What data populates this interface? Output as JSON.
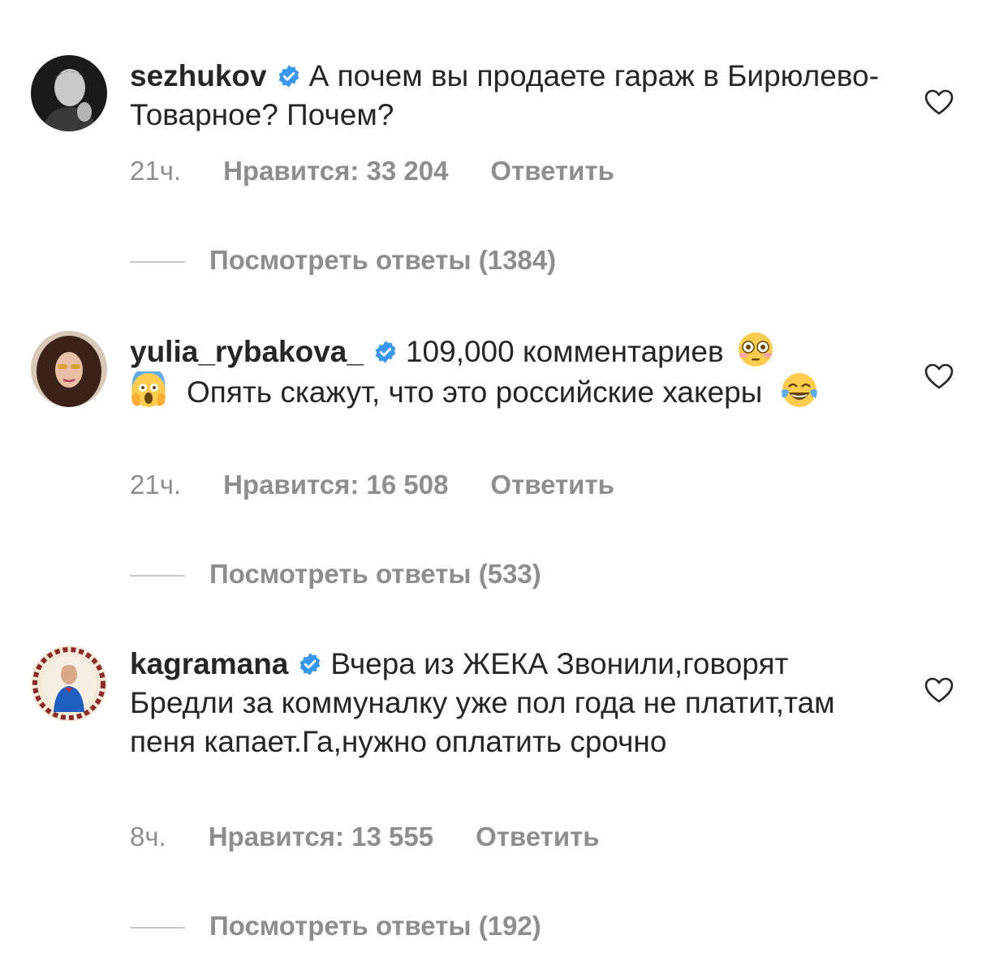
{
  "comments": [
    {
      "username": "sezhukov",
      "verified_icon": "verified-badge-icon",
      "text_1": "А почем вы продаете гараж в Бирюлево-Товарное? Почем?",
      "time": "21ч.",
      "likes": "Нравится: 33 204",
      "reply": "Ответить",
      "view_replies": "Посмотреть ответы (1384)",
      "like_icon": "heart-outline-icon"
    },
    {
      "username": "yulia_rybakova_",
      "verified_icon": "verified-badge-icon",
      "text_1": "109,000 комментариев",
      "emoji_1": "flushed-face-emoji",
      "emoji_2": "screaming-face-emoji",
      "text_2": "Опять скажут, что это российские хакеры",
      "emoji_3": "tears-of-joy-emoji",
      "time": "21ч.",
      "likes": "Нравится: 16 508",
      "reply": "Ответить",
      "view_replies": "Посмотреть ответы (533)",
      "like_icon": "heart-outline-icon"
    },
    {
      "username": "kagramana",
      "verified_icon": "verified-badge-icon",
      "text_1": "Вчера из ЖЕКА Звонили,говорят Бредли за коммуналку уже пол года не платит,там пеня капает.Га,нужно оплатить срочно",
      "time": "8ч.",
      "likes": "Нравится: 13 555",
      "reply": "Ответить",
      "view_replies": "Посмотреть ответы (192)",
      "like_icon": "heart-outline-icon"
    }
  ],
  "colors": {
    "text": "#262626",
    "secondary": "#8e8e8e",
    "verified_blue": "#3897f0",
    "divider": "#c7c7c7"
  }
}
